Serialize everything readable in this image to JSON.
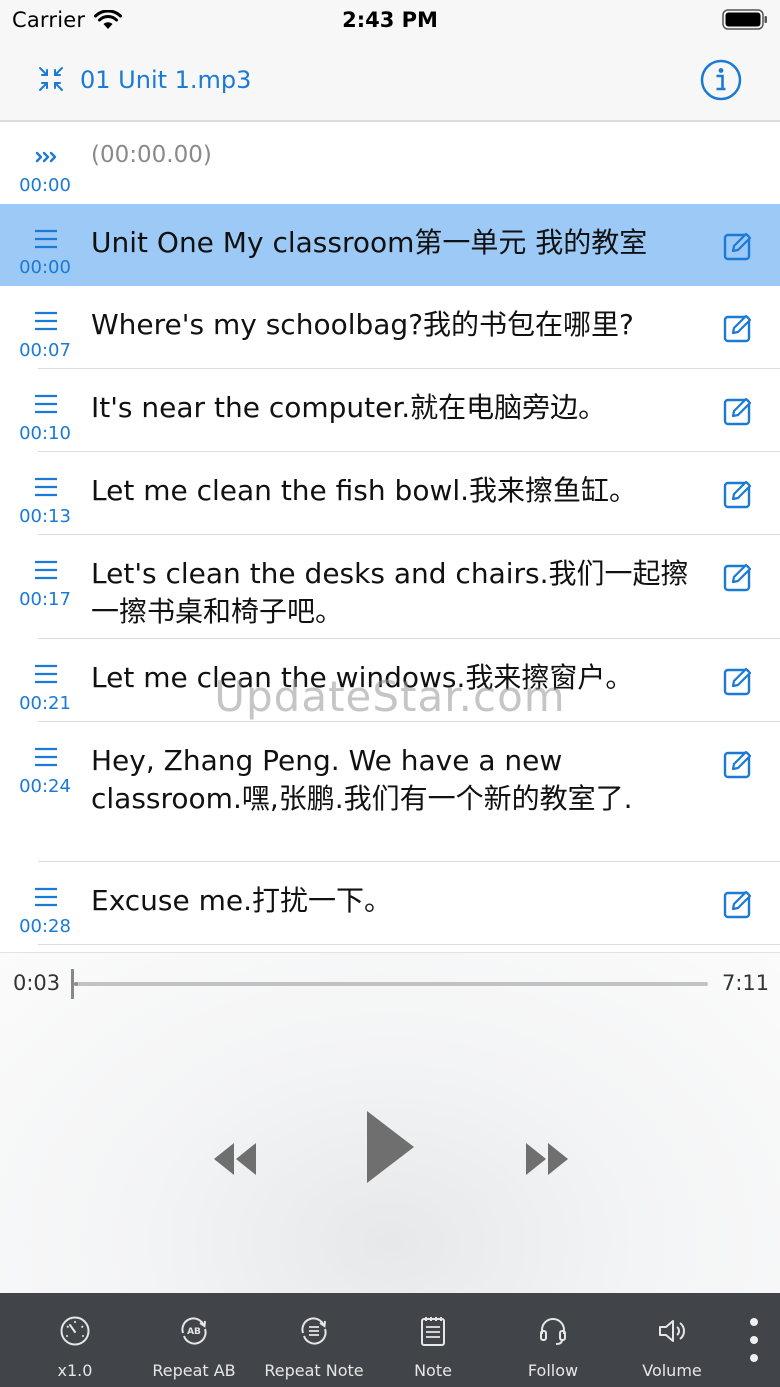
{
  "status": {
    "carrier": "Carrier",
    "time": "2:43 PM"
  },
  "nav": {
    "title": "01 Unit 1.mp3"
  },
  "list": {
    "header": {
      "text": "(00:00.00)",
      "time": "00:00"
    },
    "rows": [
      {
        "time": "00:00",
        "text": "Unit One My classroom第一单元 我的教室"
      },
      {
        "time": "00:07",
        "text": "Where's my schoolbag?我的书包在哪里?"
      },
      {
        "time": "00:10",
        "text": "It's near the computer.就在电脑旁边。"
      },
      {
        "time": "00:13",
        "text": "Let me clean the fish bowl.我来擦鱼缸。"
      },
      {
        "time": "00:17",
        "text": "Let's clean the desks and chairs.我们一起擦一擦书桌和椅子吧。"
      },
      {
        "time": "00:21",
        "text": "Let me clean the windows.我来擦窗户。"
      },
      {
        "time": "00:24",
        "text": "Hey, Zhang Peng. We have a new classroom.嘿,张鹏.我们有一个新的教室了."
      },
      {
        "time": "00:28",
        "text": "Excuse me.打扰一下。"
      }
    ]
  },
  "watermark": "UpdateStar.com",
  "player": {
    "current": "0:03",
    "total": "7:11",
    "progress": 0.007
  },
  "tabs": [
    {
      "label": "x1.0",
      "icon": "speed-gauge-icon"
    },
    {
      "label": "Repeat AB",
      "icon": "repeat-ab-icon"
    },
    {
      "label": "Repeat Note",
      "icon": "repeat-note-icon"
    },
    {
      "label": "Note",
      "icon": "note-icon"
    },
    {
      "label": "Follow",
      "icon": "headset-icon"
    },
    {
      "label": "Volume",
      "icon": "volume-icon"
    }
  ],
  "colors": {
    "accent": "#1a7ad6",
    "selected_row": "#9cc9f5",
    "tab_bar": "#414549"
  }
}
